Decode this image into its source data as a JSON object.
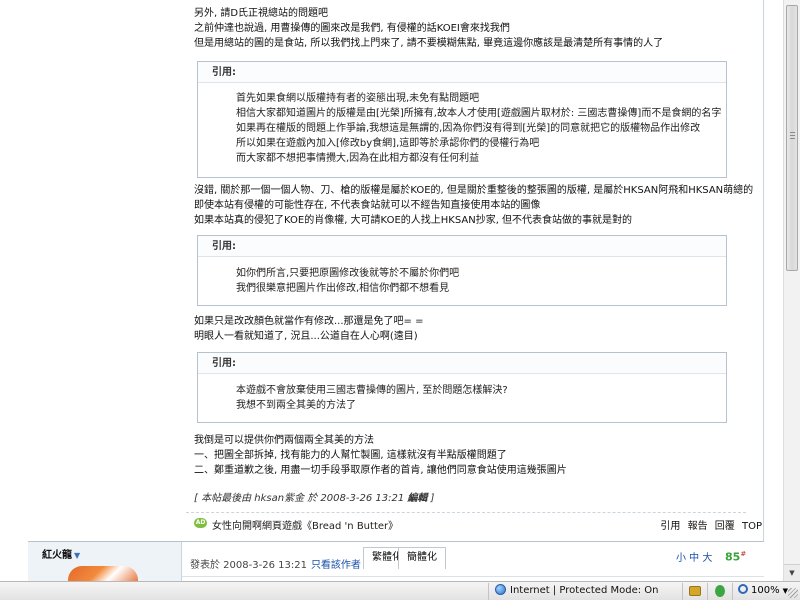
{
  "post": {
    "intro_lines": [
      "另外, 請D氏正視總站的問題吧",
      "之前仲達也說過, 用曹操傳的圖來改是我們, 有侵權的話KOEI會來找我們",
      "但是用總站的圖的是食站, 所以我們找上門來了, 請不要模糊焦點, 畢竟這邊你應該是最清楚所有事情的人了"
    ],
    "quote1": {
      "header": "引用:",
      "lines": [
        "首先如果食網以版權持有者的姿態出現,未免有點問題吧",
        "相信大家都知道圖片的版權是由[光榮]所擁有,故本人才使用[遊戲圖片取材於: 三國志曹操傳]而不是食網的名字",
        "如果再在權版的問題上作爭論,我想這是無謂的,因為你們沒有得到[光榮]的同意就把它的版權物品作出修改",
        "所以如果在遊戲內加入[修改by食網],這即等於承認你們的侵權行為吧",
        "而大家都不想把事情攪大,因為在此相方都沒有任何利益"
      ]
    },
    "middle_lines": [
      "沒錯, 關於那一個一個人物、刀、槍的版權是屬於KOE的, 但是關於重整後的整張圖的版權, 是屬於HKSAN阿飛和HKSAN萌總的",
      "即使本站有侵權的可能性存在, 不代表食站就可以不經告知直接使用本站的圖像",
      "如果本站真的侵犯了KOE的肖像權, 大可請KOE的人找上HKSAN抄家, 但不代表食站做的事就是對的"
    ],
    "quote2": {
      "header": "引用:",
      "lines": [
        "如你們所言,只要把原圖修改後就等於不屬於你們吧",
        "我們很樂意把圖片作出修改,相信你們都不想看見"
      ]
    },
    "after_quote2_lines": [
      "如果只是改改顏色就當作有修改...那還是免了吧= =",
      "明眼人一看就知道了, 況且...公道自在人心啊(遠目)"
    ],
    "quote3": {
      "header": "引用:",
      "lines": [
        "本遊戲不會放棄使用三國志曹操傳的圖片, 至於問題怎樣解決?",
        "我想不到兩全其美的方法了"
      ]
    },
    "closing_lines": [
      "我倒是可以提供你們兩個兩全其美的方法",
      "一、把圖全部拆掉, 找有能力的人幫忙製圖, 這樣就沒有半點版權問題了",
      "二、鄭重道歉之後, 用盡一切手段爭取原作者的首肯, 讓他們同意食站使用這幾張圖片"
    ],
    "edit_note": {
      "prefix": "[ ",
      "text": "本帖最後由 hksan紫金 於 2008-3-26 13:21 ",
      "bold": "編輯",
      "suffix": " ]"
    }
  },
  "signature_bar": {
    "ad_icon_text": "AD",
    "link_text": "女性向開啊網頁遊戲《Bread 'n Butter》",
    "actions": [
      "引用",
      "報告",
      "回覆",
      "TOP"
    ]
  },
  "next_post": {
    "author": "紅火龍",
    "posted_on": "發表於 2008-3-26 13:21",
    "only_author": "只看該作者",
    "convert_traditional": "繁體化",
    "convert_simplified": "簡體化",
    "font_sizes": "小 中 大",
    "floor": "85",
    "floor_sup": "#"
  },
  "statusbar": {
    "zone": "Internet | Protected Mode: On",
    "zoom": "100%"
  }
}
